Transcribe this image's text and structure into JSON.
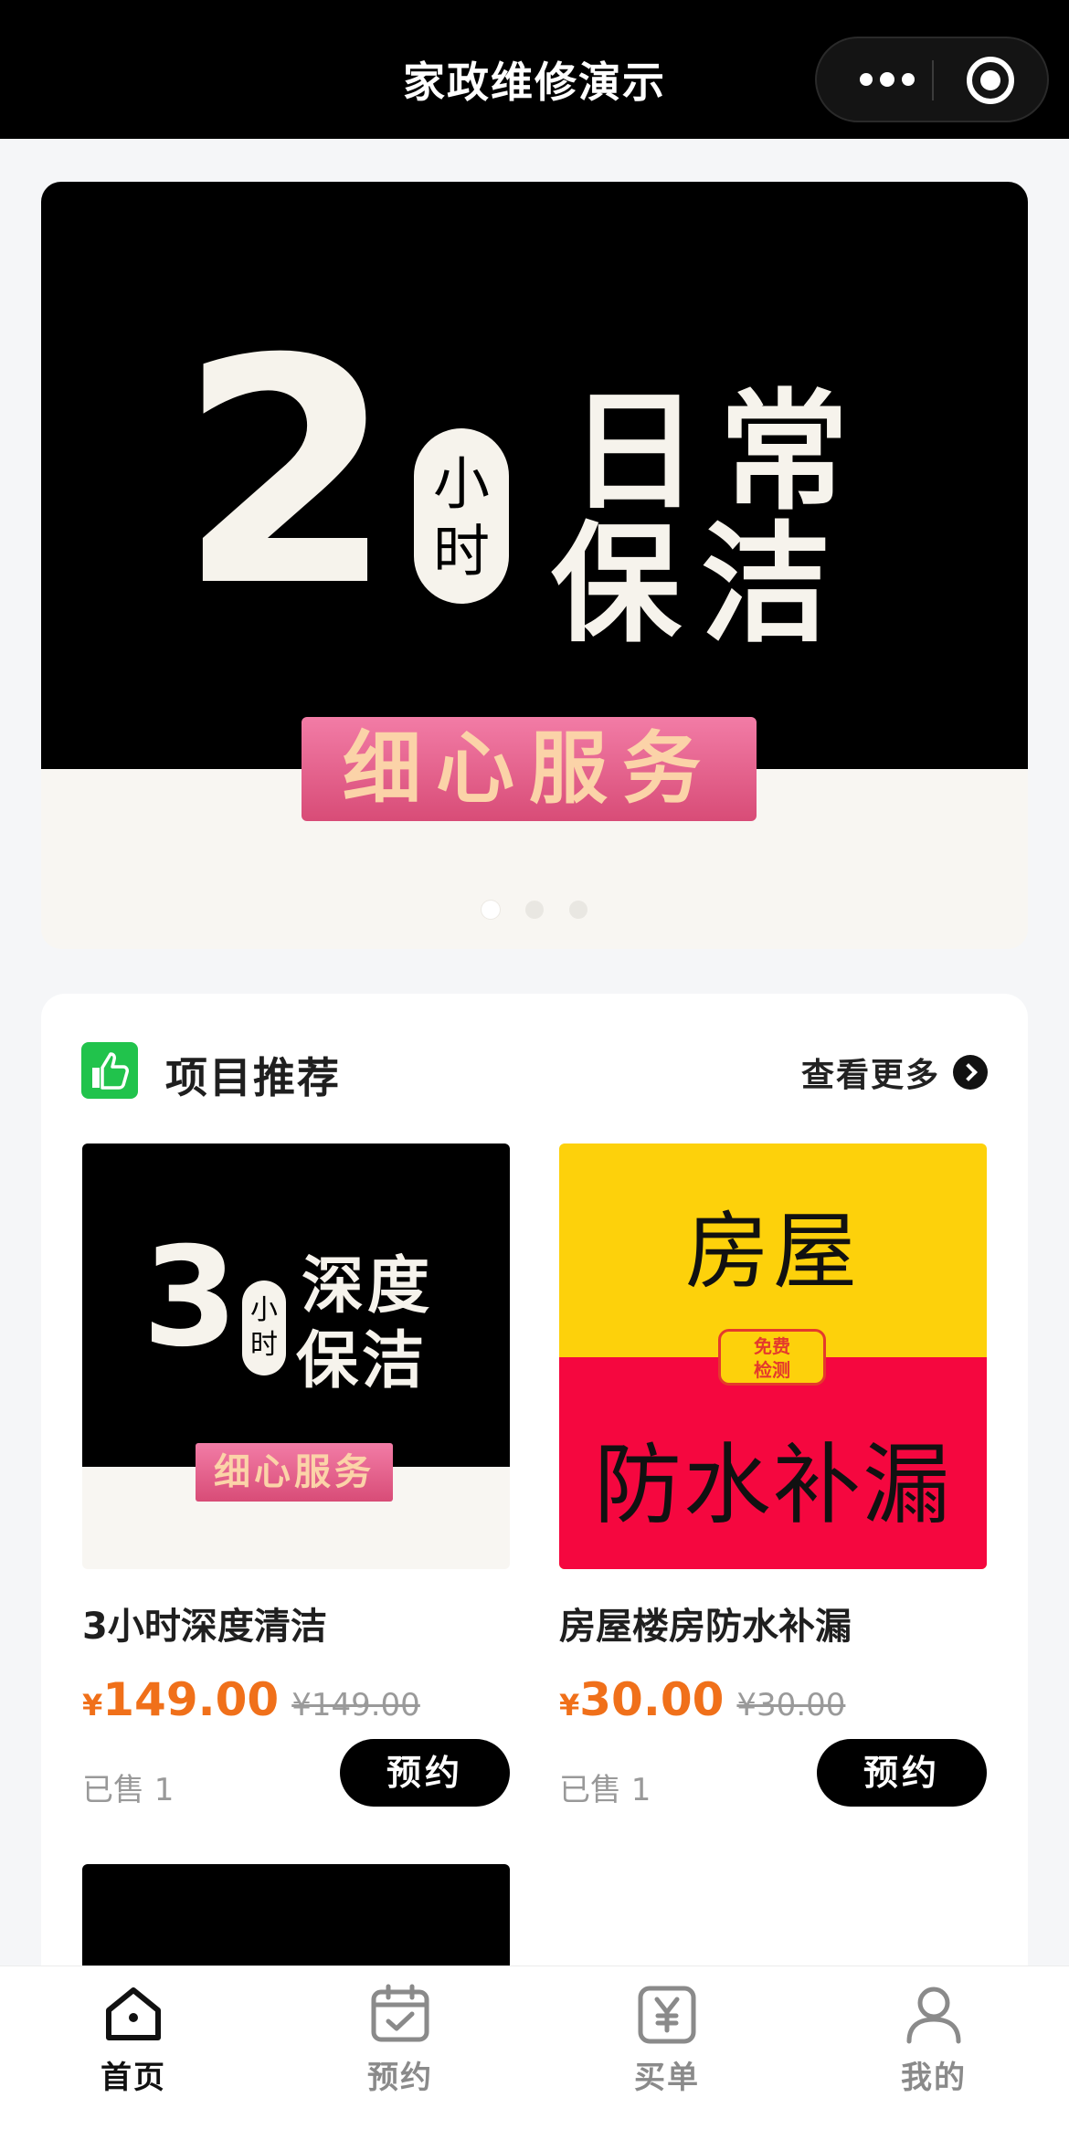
{
  "header": {
    "title": "家政维修演示",
    "more_icon": "more-dots-icon",
    "close_icon": "target-icon"
  },
  "banner": {
    "big_number": "2",
    "unit_top": "小",
    "unit_bottom": "时",
    "line1": "日常",
    "line2": "保洁",
    "ribbon": "细心服务",
    "indicator_count": 3,
    "active_index": 0
  },
  "section": {
    "icon": "thumbs-up-icon",
    "title": "项目推荐",
    "more_label": "查看更多",
    "more_icon": "chevron-right-icon"
  },
  "products": [
    {
      "image": {
        "number": "3",
        "unit_top": "小",
        "unit_bottom": "时",
        "line1": "深度",
        "line2": "保洁",
        "ribbon": "细心服务"
      },
      "name": "3小时深度清洁",
      "currency": "¥",
      "price": "149.00",
      "original_price": "¥149.00",
      "sold": "已售 1",
      "button": "预约"
    },
    {
      "image": {
        "line1": "房屋",
        "badge_top": "免费",
        "badge_bottom": "检测",
        "line2": "防水补漏"
      },
      "name": "房屋楼房防水补漏",
      "currency": "¥",
      "price": "30.00",
      "original_price": "¥30.00",
      "sold": "已售 1",
      "button": "预约"
    }
  ],
  "tabbar": [
    {
      "label": "首页",
      "icon": "home-icon",
      "active": true
    },
    {
      "label": "预约",
      "icon": "calendar-check-icon",
      "active": false
    },
    {
      "label": "买单",
      "icon": "yuan-bill-icon",
      "active": false
    },
    {
      "label": "我的",
      "icon": "user-icon",
      "active": false
    }
  ],
  "colors": {
    "accent_price": "#f0701a",
    "brand_green": "#21c34c",
    "button_black": "#000000"
  }
}
